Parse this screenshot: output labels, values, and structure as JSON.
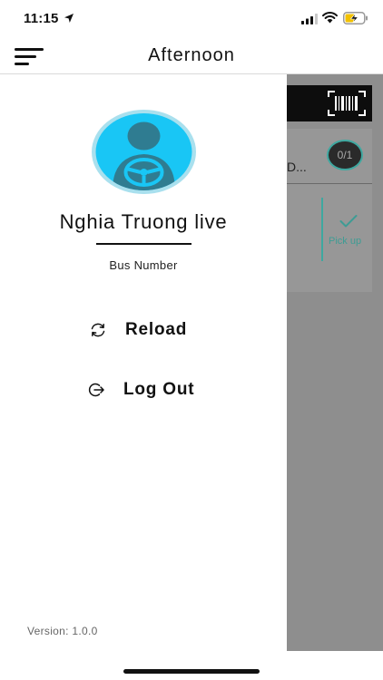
{
  "status_bar": {
    "time": "11:15",
    "icons": [
      "location-arrow-icon",
      "signal-icon",
      "wifi-icon",
      "battery-charging-icon"
    ]
  },
  "header": {
    "title": "Afternoon",
    "menu_icon": "hamburger-menu-icon"
  },
  "drawer": {
    "avatar_icon": "driver-avatar-icon",
    "driver_name": "Nghia Truong live",
    "bus_number_label": "Bus Number",
    "menu": [
      {
        "label": "Reload",
        "icon": "reload-icon"
      },
      {
        "label": "Log Out",
        "icon": "logout-icon"
      }
    ],
    "version": "Version: 1.0.0"
  },
  "background_screen": {
    "stop_title_partial": "D...",
    "count_badge": "0/1",
    "pickup_label": "Pick up",
    "barcode_icon": "barcode-scan-icon"
  },
  "colors": {
    "accent": "#3ea8a0",
    "avatar_blue": "#19c6f5",
    "overlay": "#8e8e8e"
  }
}
